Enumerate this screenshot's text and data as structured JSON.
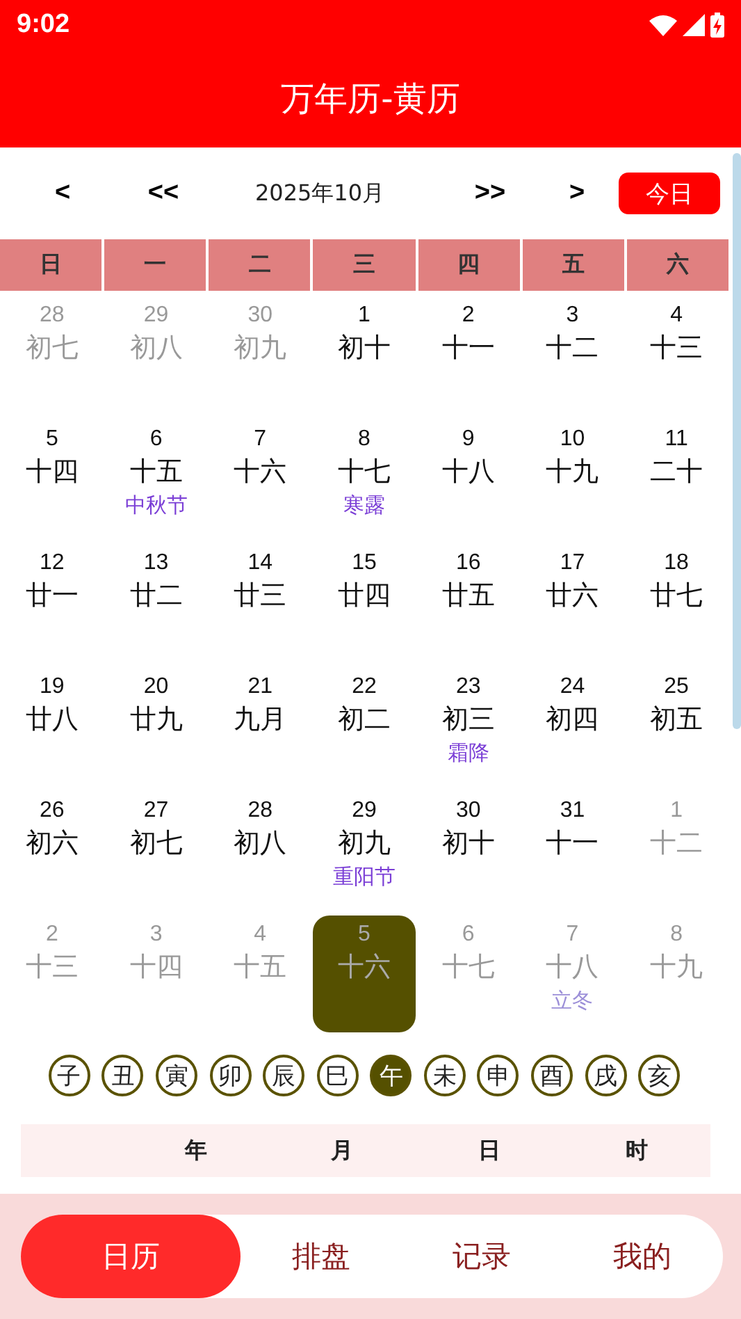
{
  "status_bar": {
    "time": "9:02"
  },
  "header": {
    "title": "万年历-黄历"
  },
  "nav": {
    "prev_month": "<",
    "prev_year": "<<",
    "current": "2025年10月",
    "next_year": ">>",
    "next_month": ">",
    "today_button": "今日"
  },
  "weekdays": [
    "日",
    "一",
    "二",
    "三",
    "四",
    "五",
    "六"
  ],
  "days": [
    {
      "day": "28",
      "lunar": "初七",
      "other_month": true,
      "selected": false
    },
    {
      "day": "29",
      "lunar": "初八",
      "other_month": true,
      "selected": false
    },
    {
      "day": "30",
      "lunar": "初九",
      "other_month": true,
      "selected": false
    },
    {
      "day": "1",
      "lunar": "初十",
      "other_month": false,
      "selected": false
    },
    {
      "day": "2",
      "lunar": "十一",
      "other_month": false,
      "selected": false
    },
    {
      "day": "3",
      "lunar": "十二",
      "other_month": false,
      "selected": false
    },
    {
      "day": "4",
      "lunar": "十三",
      "other_month": false,
      "selected": false
    },
    {
      "day": "5",
      "lunar": "十四",
      "other_month": false,
      "selected": false
    },
    {
      "day": "6",
      "lunar": "十五",
      "festival": "中秋节",
      "other_month": false,
      "selected": false
    },
    {
      "day": "7",
      "lunar": "十六",
      "other_month": false,
      "selected": false
    },
    {
      "day": "8",
      "lunar": "十七",
      "festival": "寒露",
      "other_month": false,
      "selected": false
    },
    {
      "day": "9",
      "lunar": "十八",
      "other_month": false,
      "selected": false
    },
    {
      "day": "10",
      "lunar": "十九",
      "other_month": false,
      "selected": false
    },
    {
      "day": "11",
      "lunar": "二十",
      "other_month": false,
      "selected": false
    },
    {
      "day": "12",
      "lunar": "廿一",
      "other_month": false,
      "selected": false
    },
    {
      "day": "13",
      "lunar": "廿二",
      "other_month": false,
      "selected": false
    },
    {
      "day": "14",
      "lunar": "廿三",
      "other_month": false,
      "selected": false
    },
    {
      "day": "15",
      "lunar": "廿四",
      "other_month": false,
      "selected": false
    },
    {
      "day": "16",
      "lunar": "廿五",
      "other_month": false,
      "selected": false
    },
    {
      "day": "17",
      "lunar": "廿六",
      "other_month": false,
      "selected": false
    },
    {
      "day": "18",
      "lunar": "廿七",
      "other_month": false,
      "selected": false
    },
    {
      "day": "19",
      "lunar": "廿八",
      "other_month": false,
      "selected": false
    },
    {
      "day": "20",
      "lunar": "廿九",
      "other_month": false,
      "selected": false
    },
    {
      "day": "21",
      "lunar": "九月",
      "other_month": false,
      "selected": false
    },
    {
      "day": "22",
      "lunar": "初二",
      "other_month": false,
      "selected": false
    },
    {
      "day": "23",
      "lunar": "初三",
      "festival": "霜降",
      "other_month": false,
      "selected": false
    },
    {
      "day": "24",
      "lunar": "初四",
      "other_month": false,
      "selected": false
    },
    {
      "day": "25",
      "lunar": "初五",
      "other_month": false,
      "selected": false
    },
    {
      "day": "26",
      "lunar": "初六",
      "other_month": false,
      "selected": false
    },
    {
      "day": "27",
      "lunar": "初七",
      "other_month": false,
      "selected": false
    },
    {
      "day": "28",
      "lunar": "初八",
      "other_month": false,
      "selected": false
    },
    {
      "day": "29",
      "lunar": "初九",
      "festival": "重阳节",
      "other_month": false,
      "selected": false
    },
    {
      "day": "30",
      "lunar": "初十",
      "other_month": false,
      "selected": false
    },
    {
      "day": "31",
      "lunar": "十一",
      "other_month": false,
      "selected": false
    },
    {
      "day": "1",
      "lunar": "十二",
      "other_month": true,
      "selected": false
    },
    {
      "day": "2",
      "lunar": "十三",
      "other_month": true,
      "selected": false
    },
    {
      "day": "3",
      "lunar": "十四",
      "other_month": true,
      "selected": false
    },
    {
      "day": "4",
      "lunar": "十五",
      "other_month": true,
      "selected": false
    },
    {
      "day": "5",
      "lunar": "十六",
      "other_month": true,
      "selected": true
    },
    {
      "day": "6",
      "lunar": "十七",
      "other_month": true,
      "selected": false
    },
    {
      "day": "7",
      "lunar": "十八",
      "festival": "立冬",
      "other_month": true,
      "selected": false
    },
    {
      "day": "8",
      "lunar": "十九",
      "other_month": true,
      "selected": false
    }
  ],
  "hours": [
    {
      "label": "子",
      "selected": false
    },
    {
      "label": "丑",
      "selected": false
    },
    {
      "label": "寅",
      "selected": false
    },
    {
      "label": "卯",
      "selected": false
    },
    {
      "label": "辰",
      "selected": false
    },
    {
      "label": "巳",
      "selected": false
    },
    {
      "label": "午",
      "selected": true
    },
    {
      "label": "未",
      "selected": false
    },
    {
      "label": "申",
      "selected": false
    },
    {
      "label": "酉",
      "selected": false
    },
    {
      "label": "戌",
      "selected": false
    },
    {
      "label": "亥",
      "selected": false
    }
  ],
  "pillars": {
    "columns": [
      "年",
      "月",
      "日",
      "时"
    ]
  },
  "tabs": [
    {
      "label": "日历",
      "selected": true
    },
    {
      "label": "排盘",
      "selected": false
    },
    {
      "label": "记录",
      "selected": false
    },
    {
      "label": "我的",
      "selected": false
    }
  ]
}
